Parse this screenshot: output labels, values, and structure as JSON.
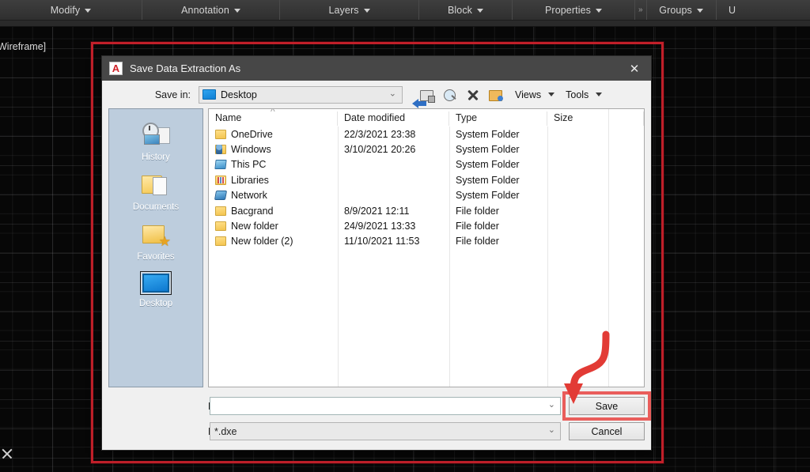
{
  "app": {
    "canvas_label": "Wireframe]",
    "cursor_marker": "x-cursor"
  },
  "ribbon": {
    "panels": [
      {
        "label": "Modify"
      },
      {
        "label": "Annotation"
      },
      {
        "label": "Layers"
      },
      {
        "label": "Block"
      },
      {
        "label": "Properties"
      }
    ],
    "overflow_chevron": "»",
    "panels_right": [
      {
        "label": "Groups"
      },
      {
        "label": "U"
      }
    ]
  },
  "dialog": {
    "title": "Save Data Extraction As",
    "logo_letter": "A",
    "close_label": "✕",
    "save_in": {
      "label": "Save in:",
      "value": "Desktop",
      "chevron": "⌄"
    },
    "toolbar": {
      "icons": [
        {
          "name": "back-arrow-icon"
        },
        {
          "name": "up-one-level-icon"
        },
        {
          "name": "search-web-icon"
        },
        {
          "name": "delete-icon"
        },
        {
          "name": "new-folder-icon"
        }
      ],
      "views_label": "Views",
      "tools_label": "Tools"
    },
    "places": [
      {
        "label": "History",
        "icon": "history-icon",
        "selected": false
      },
      {
        "label": "Documents",
        "icon": "documents-folder-icon",
        "selected": false
      },
      {
        "label": "Favorites",
        "icon": "favorites-folder-icon",
        "selected": false
      },
      {
        "label": "Desktop",
        "icon": "desktop-icon",
        "selected": true
      }
    ],
    "file_list": {
      "columns": [
        "Name",
        "Date modified",
        "Type",
        "Size"
      ],
      "sort_indicator": "^",
      "rows": [
        {
          "name": "OneDrive",
          "date": "22/3/2021 23:38",
          "type": "System Folder",
          "size": "",
          "icon": "folder-icon"
        },
        {
          "name": "Windows",
          "date": "3/10/2021 20:26",
          "type": "System Folder",
          "size": "",
          "icon": "user-folder-icon"
        },
        {
          "name": "This PC",
          "date": "",
          "type": "System Folder",
          "size": "",
          "icon": "this-pc-icon"
        },
        {
          "name": "Libraries",
          "date": "",
          "type": "System Folder",
          "size": "",
          "icon": "libraries-icon"
        },
        {
          "name": "Network",
          "date": "",
          "type": "System Folder",
          "size": "",
          "icon": "network-icon"
        },
        {
          "name": "Bacgrand",
          "date": "8/9/2021 12:11",
          "type": "File folder",
          "size": "",
          "icon": "folder-icon"
        },
        {
          "name": "New folder",
          "date": "24/9/2021 13:33",
          "type": "File folder",
          "size": "",
          "icon": "folder-icon"
        },
        {
          "name": "New folder (2)",
          "date": "11/10/2021 11:53",
          "type": "File folder",
          "size": "",
          "icon": "folder-icon"
        }
      ]
    },
    "file_name": {
      "label": "File name:",
      "value": "",
      "placeholder": "",
      "chevron": "⌄"
    },
    "files_of_type": {
      "label": "Files of type:",
      "value": "*.dxe",
      "chevron": "⌄"
    },
    "buttons": {
      "save": "Save",
      "cancel": "Cancel"
    }
  },
  "annotations": {
    "highlight_color": "#c2202a",
    "save_highlight_color": "#e8504e",
    "arrow_color": "#e23b35",
    "arrow_target": "save-button"
  }
}
